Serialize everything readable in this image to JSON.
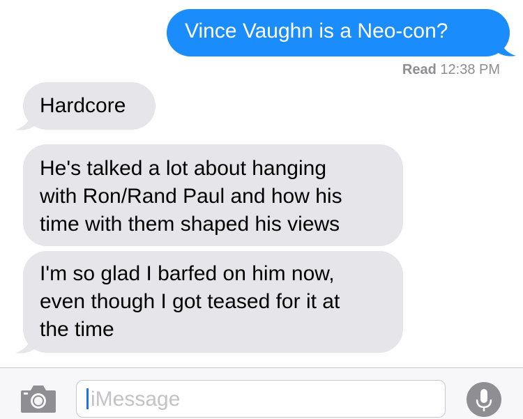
{
  "conversation": {
    "sent": {
      "text": "Vince Vaughn is a Neo-con?",
      "color": "#1a8cfb"
    },
    "read_receipt": {
      "status": "Read",
      "time": "12:38 PM"
    },
    "received": [
      {
        "text": "Hardcore"
      },
      {
        "text": "He's talked a lot about hanging\nwith Ron/Rand Paul and how his\ntime with them shaped his views"
      },
      {
        "text": "I'm so glad I barfed on him now,\neven though I got teased for it at\nthe time"
      }
    ],
    "received_color": "#e5e5ea"
  },
  "input_bar": {
    "placeholder": "iMessage",
    "camera_icon": "camera-icon",
    "mic_icon": "microphone-icon"
  }
}
